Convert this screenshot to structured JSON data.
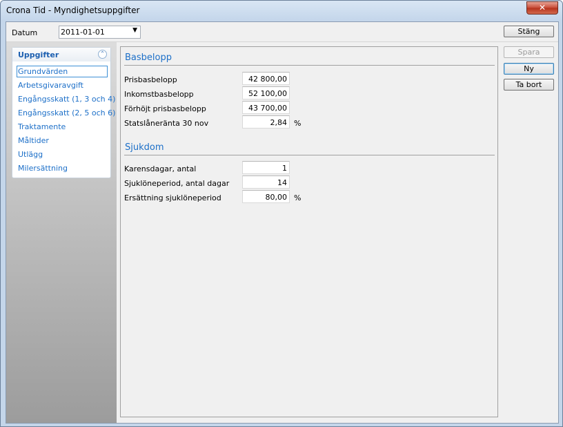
{
  "window": {
    "title": "Crona Tid - Myndighetsuppgifter",
    "close_glyph": "✕"
  },
  "toolbar": {
    "datum_label": "Datum",
    "datum_value": "2011-01-01",
    "dropdown_glyph": "▼"
  },
  "buttons": {
    "stang": "Stäng",
    "spara": "Spara",
    "ny": "Ny",
    "ta_bort": "Ta bort"
  },
  "nav": {
    "header": "Uppgifter",
    "collapse_glyph": "⌃",
    "items": [
      {
        "label": "Grundvärden"
      },
      {
        "label": "Arbetsgivaravgift"
      },
      {
        "label": "Engångsskatt (1, 3 och 4)"
      },
      {
        "label": "Engångsskatt (2, 5 och 6)"
      },
      {
        "label": "Traktamente"
      },
      {
        "label": "Måltider"
      },
      {
        "label": "Utlägg"
      },
      {
        "label": "Milersättning"
      }
    ]
  },
  "basbelopp": {
    "title": "Basbelopp",
    "fields": [
      {
        "label": "Prisbasbelopp",
        "value": "42 800,00",
        "unit": ""
      },
      {
        "label": "Inkomstbasbelopp",
        "value": "52 100,00",
        "unit": ""
      },
      {
        "label": "Förhöjt prisbasbelopp",
        "value": "43 700,00",
        "unit": ""
      },
      {
        "label": "Statslåneränta 30 nov",
        "value": "2,84",
        "unit": "%"
      }
    ]
  },
  "sjukdom": {
    "title": "Sjukdom",
    "fields": [
      {
        "label": "Karensdagar,  antal",
        "value": "1",
        "unit": ""
      },
      {
        "label": "Sjuklöneperiod,  antal dagar",
        "value": "14",
        "unit": ""
      },
      {
        "label": "Ersättning sjuklöneperiod",
        "value": "80,00",
        "unit": "%"
      }
    ]
  },
  "colors": {
    "accent": "#1c6fc8",
    "frame": "#c4d6ea",
    "close": "#c74a36"
  }
}
